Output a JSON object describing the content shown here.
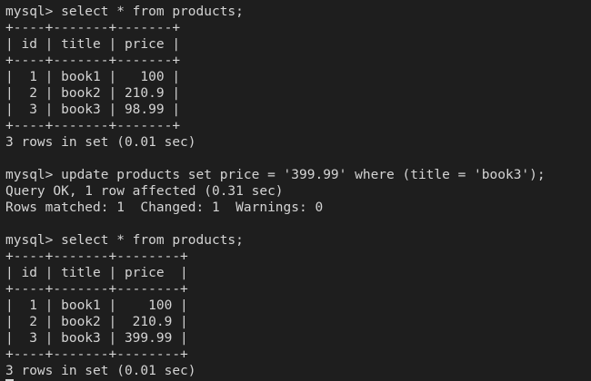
{
  "terminal": {
    "lines": [
      "mysql> select * from products;",
      "+----+-------+-------+",
      "| id | title | price |",
      "+----+-------+-------+",
      "|  1 | book1 |   100 |",
      "|  2 | book2 | 210.9 |",
      "|  3 | book3 | 98.99 |",
      "+----+-------+-------+",
      "3 rows in set (0.01 sec)",
      "",
      "mysql> update products set price = '399.99' where (title = 'book3');",
      "Query OK, 1 row affected (0.31 sec)",
      "Rows matched: 1  Changed: 1  Warnings: 0",
      "",
      "mysql> select * from products;",
      "+----+-------+--------+",
      "| id | title | price  |",
      "+----+-------+--------+",
      "|  1 | book1 |    100 |",
      "|  2 | book2 |  210.9 |",
      "|  3 | book3 | 399.99 |",
      "+----+-------+--------+",
      "3 rows in set (0.01 sec)"
    ]
  }
}
